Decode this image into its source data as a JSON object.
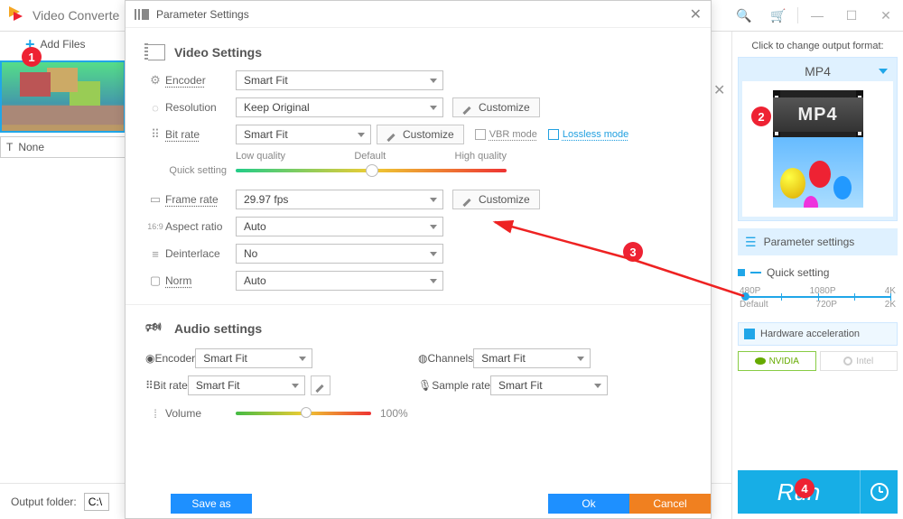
{
  "app": {
    "title": "Video Converte"
  },
  "titlebar": {
    "icons": [
      "search",
      "cart",
      "min",
      "max",
      "close"
    ]
  },
  "left": {
    "add_files": "Add Files",
    "none_label": "None"
  },
  "output": {
    "label": "Output folder:",
    "path": "C:\\"
  },
  "right": {
    "hint": "Click to change output format:",
    "format_label": "MP4",
    "tile_text": "MP4",
    "param_btn": "Parameter settings",
    "quick_title": "Quick setting",
    "res_top": [
      "480P",
      "1080P",
      "4K"
    ],
    "res_bot": [
      "Default",
      "720P",
      "2K"
    ],
    "hw_label": "Hardware acceleration",
    "gpu_nvidia": "NVIDIA",
    "gpu_intel": "Intel",
    "run": "Run"
  },
  "modal": {
    "title": "Parameter Settings",
    "video_section": "Video Settings",
    "audio_section": "Audio settings",
    "labels": {
      "encoder": "Encoder",
      "resolution": "Resolution",
      "bitrate": "Bit rate",
      "framerate": "Frame rate",
      "aspect": "Aspect ratio",
      "deinterlace": "Deinterlace",
      "norm": "Norm",
      "channels": "Channels",
      "samplerate": "Sample rate",
      "volume": "Volume",
      "quick_setting": "Quick setting"
    },
    "values": {
      "v_encoder": "Smart Fit",
      "v_resolution": "Keep Original",
      "v_bitrate": "Smart Fit",
      "v_framerate": "29.97 fps",
      "v_aspect": "Auto",
      "v_deinterlace": "No",
      "v_norm": "Auto",
      "a_encoder": "Smart Fit",
      "a_bitrate": "Smart Fit",
      "a_channels": "Smart Fit",
      "a_samplerate": "Smart Fit",
      "volume_pct": "100%"
    },
    "quality": {
      "low": "Low quality",
      "mid": "Default",
      "high": "High quality"
    },
    "customize": "Customize",
    "vbr": "VBR mode",
    "lossless": "Lossless mode",
    "buttons": {
      "save": "Save as",
      "ok": "Ok",
      "cancel": "Cancel"
    }
  },
  "callouts": {
    "one": "1",
    "two": "2",
    "three": "3",
    "four": "4"
  }
}
